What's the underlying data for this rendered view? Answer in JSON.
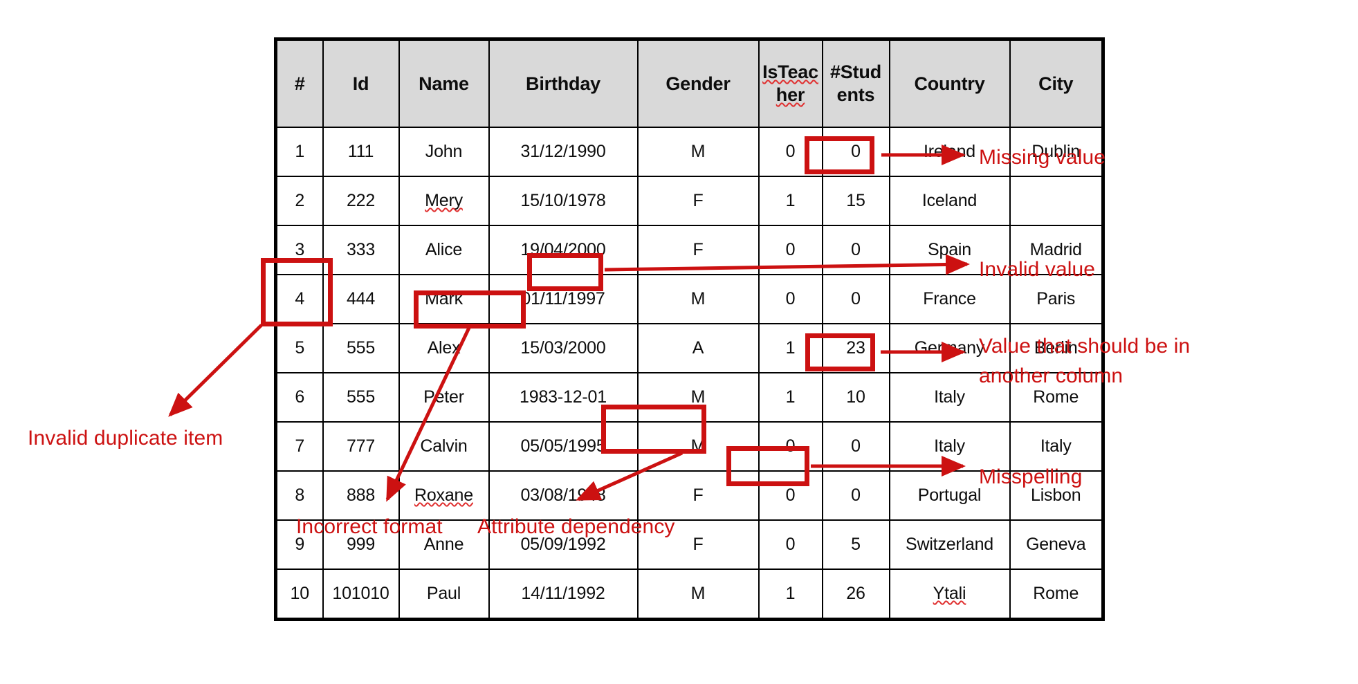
{
  "table": {
    "columns": [
      {
        "key": "num",
        "label": "#"
      },
      {
        "key": "id",
        "label": "Id"
      },
      {
        "key": "name",
        "label": "Name"
      },
      {
        "key": "birthday",
        "label": "Birthday"
      },
      {
        "key": "gender",
        "label": "Gender"
      },
      {
        "key": "teacher",
        "label": "IsTeac\nher"
      },
      {
        "key": "students",
        "label": "#Stud\nents"
      },
      {
        "key": "country",
        "label": "Country"
      },
      {
        "key": "city",
        "label": "City"
      }
    ],
    "rows": [
      {
        "num": "1",
        "id": "111",
        "name": "John",
        "birthday": "31/12/1990",
        "gender": "M",
        "teacher": "0",
        "students": "0",
        "country": "Ireland",
        "city": "Dublin"
      },
      {
        "num": "2",
        "id": "222",
        "name": "Mery",
        "birthday": "15/10/1978",
        "gender": "F",
        "teacher": "1",
        "students": "15",
        "country": "Iceland",
        "city": ""
      },
      {
        "num": "3",
        "id": "333",
        "name": "Alice",
        "birthday": "19/04/2000",
        "gender": "F",
        "teacher": "0",
        "students": "0",
        "country": "Spain",
        "city": "Madrid"
      },
      {
        "num": "4",
        "id": "444",
        "name": "Mark",
        "birthday": "01/11/1997",
        "gender": "M",
        "teacher": "0",
        "students": "0",
        "country": "France",
        "city": "Paris"
      },
      {
        "num": "5",
        "id": "555",
        "name": "Alex",
        "birthday": "15/03/2000",
        "gender": "A",
        "teacher": "1",
        "students": "23",
        "country": "Germany",
        "city": "Berlin"
      },
      {
        "num": "6",
        "id": "555",
        "name": "Peter",
        "birthday": "1983-12-01",
        "gender": "M",
        "teacher": "1",
        "students": "10",
        "country": "Italy",
        "city": "Rome"
      },
      {
        "num": "7",
        "id": "777",
        "name": "Calvin",
        "birthday": "05/05/1995",
        "gender": "M",
        "teacher": "0",
        "students": "0",
        "country": "Italy",
        "city": "Italy"
      },
      {
        "num": "8",
        "id": "888",
        "name": "Roxane",
        "birthday": "03/08/1948",
        "gender": "F",
        "teacher": "0",
        "students": "0",
        "country": "Portugal",
        "city": "Lisbon"
      },
      {
        "num": "9",
        "id": "999",
        "name": "Anne",
        "birthday": "05/09/1992",
        "gender": "F",
        "teacher": "0",
        "students": "5",
        "country": "Switzerland",
        "city": "Geneva"
      },
      {
        "num": "10",
        "id": "101010",
        "name": "Paul",
        "birthday": "14/11/1992",
        "gender": "M",
        "teacher": "1",
        "students": "26",
        "country": "Ytali",
        "city": "Rome"
      }
    ]
  },
  "annotations": {
    "missing_value": "Missing value",
    "invalid_value": "Invalid value",
    "should_be_other_col": "Value that should be in\nanother column",
    "misspelling": "Misspelling",
    "invalid_duplicate": "Invalid duplicate item",
    "incorrect_format": "Incorrect format",
    "attribute_dependency": "Attribute dependency"
  },
  "colors": {
    "annotation_red": "#cc1111",
    "value_red": "#cc0000",
    "header_fill": "#d9d9d9",
    "grid_black": "#000000"
  }
}
